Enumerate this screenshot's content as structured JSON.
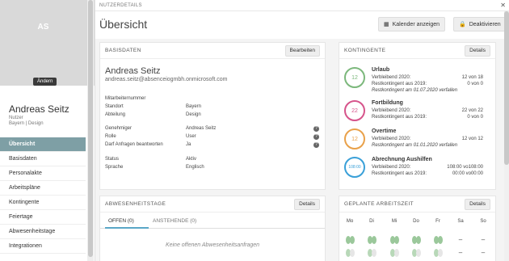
{
  "sidebar": {
    "initials": "AS",
    "change_label": "Ändern",
    "user_name": "Andreas Seitz",
    "user_role": "Nutzer",
    "user_location": "Bayern | Design",
    "items": [
      {
        "label": "Übersicht"
      },
      {
        "label": "Basisdaten"
      },
      {
        "label": "Personalakte"
      },
      {
        "label": "Arbeitspläne"
      },
      {
        "label": "Kontingente"
      },
      {
        "label": "Feiertage"
      },
      {
        "label": "Abwesenheitstage"
      },
      {
        "label": "Integrationen"
      }
    ]
  },
  "topbar": {
    "label": "NUTZERDETAILS"
  },
  "header": {
    "title": "Übersicht",
    "calendar_label": "Kalender anzeigen",
    "deactivate_label": "Deaktivieren"
  },
  "basisdaten": {
    "title": "BASISDATEN",
    "edit_label": "Bearbeiten",
    "name": "Andreas Seitz",
    "email": "andreas.seitz@absenceiogmbh.onmicrosoft.com",
    "rows": [
      {
        "key": "Mitarbeiternummer",
        "value": ""
      },
      {
        "key": "Standort",
        "value": "Bayern"
      },
      {
        "key": "Abteilung",
        "value": "Design"
      },
      {
        "key": "Genehmiger",
        "value": "Andreas Seitz"
      },
      {
        "key": "Rolle",
        "value": "User"
      },
      {
        "key": "Darf Anfragen beantworten",
        "value": "Ja"
      },
      {
        "key": "Status",
        "value": "Aktiv"
      },
      {
        "key": "Sprache",
        "value": "Englisch"
      }
    ]
  },
  "kontingente": {
    "title": "KONTINGENTE",
    "details_label": "Details",
    "items": [
      {
        "ring": "12",
        "color": "#7cb87c",
        "title": "Urlaub",
        "line1_label": "Verbleibend 2020:",
        "line1_value": "12 von  18",
        "line2_label": "Restkontingent aus 2019:",
        "line2_value": "0 von   0",
        "note": "Restkontingent am 01.07.2020 verfallen"
      },
      {
        "ring": "22",
        "color": "#d6548b",
        "title": "Fortbildung",
        "line1_label": "Verbleibend 2020:",
        "line1_value": "22 von  22",
        "line2_label": "Restkontingent aus 2019:",
        "line2_value": "0 von   0",
        "note": ""
      },
      {
        "ring": "12",
        "color": "#e9a14a",
        "title": "Overtime",
        "line1_label": "Verbleibend 2020:",
        "line1_value": "12 von  12",
        "line2_label": "",
        "line2_value": "",
        "note": "Restkontingent am 01.01.2020 verfallen"
      },
      {
        "ring": "108:00",
        "color": "#3aa0d8",
        "title": "Abrechnung Aushilfen",
        "line1_label": "Verbleibend 2020:",
        "line1_value": "108:00 vo108:00",
        "line2_label": "Restkontingent aus 2019:",
        "line2_value": "00:00 vo00:00",
        "note": ""
      }
    ]
  },
  "abwesenheit": {
    "title": "ABWESENHEITSTAGE",
    "details_label": "Details",
    "tab_open": "OFFEN (0)",
    "tab_pending": "ANSTEHENDE (0)",
    "empty_text": "Keine offenen Abwesenheitsanfragen"
  },
  "arbeitszeit": {
    "title": "GEPLANTE ARBEITSZEIT",
    "details_label": "Details",
    "days": [
      "Mo",
      "Di",
      "Mi",
      "Do",
      "Fr",
      "Sa",
      "So"
    ],
    "dash": "–"
  }
}
